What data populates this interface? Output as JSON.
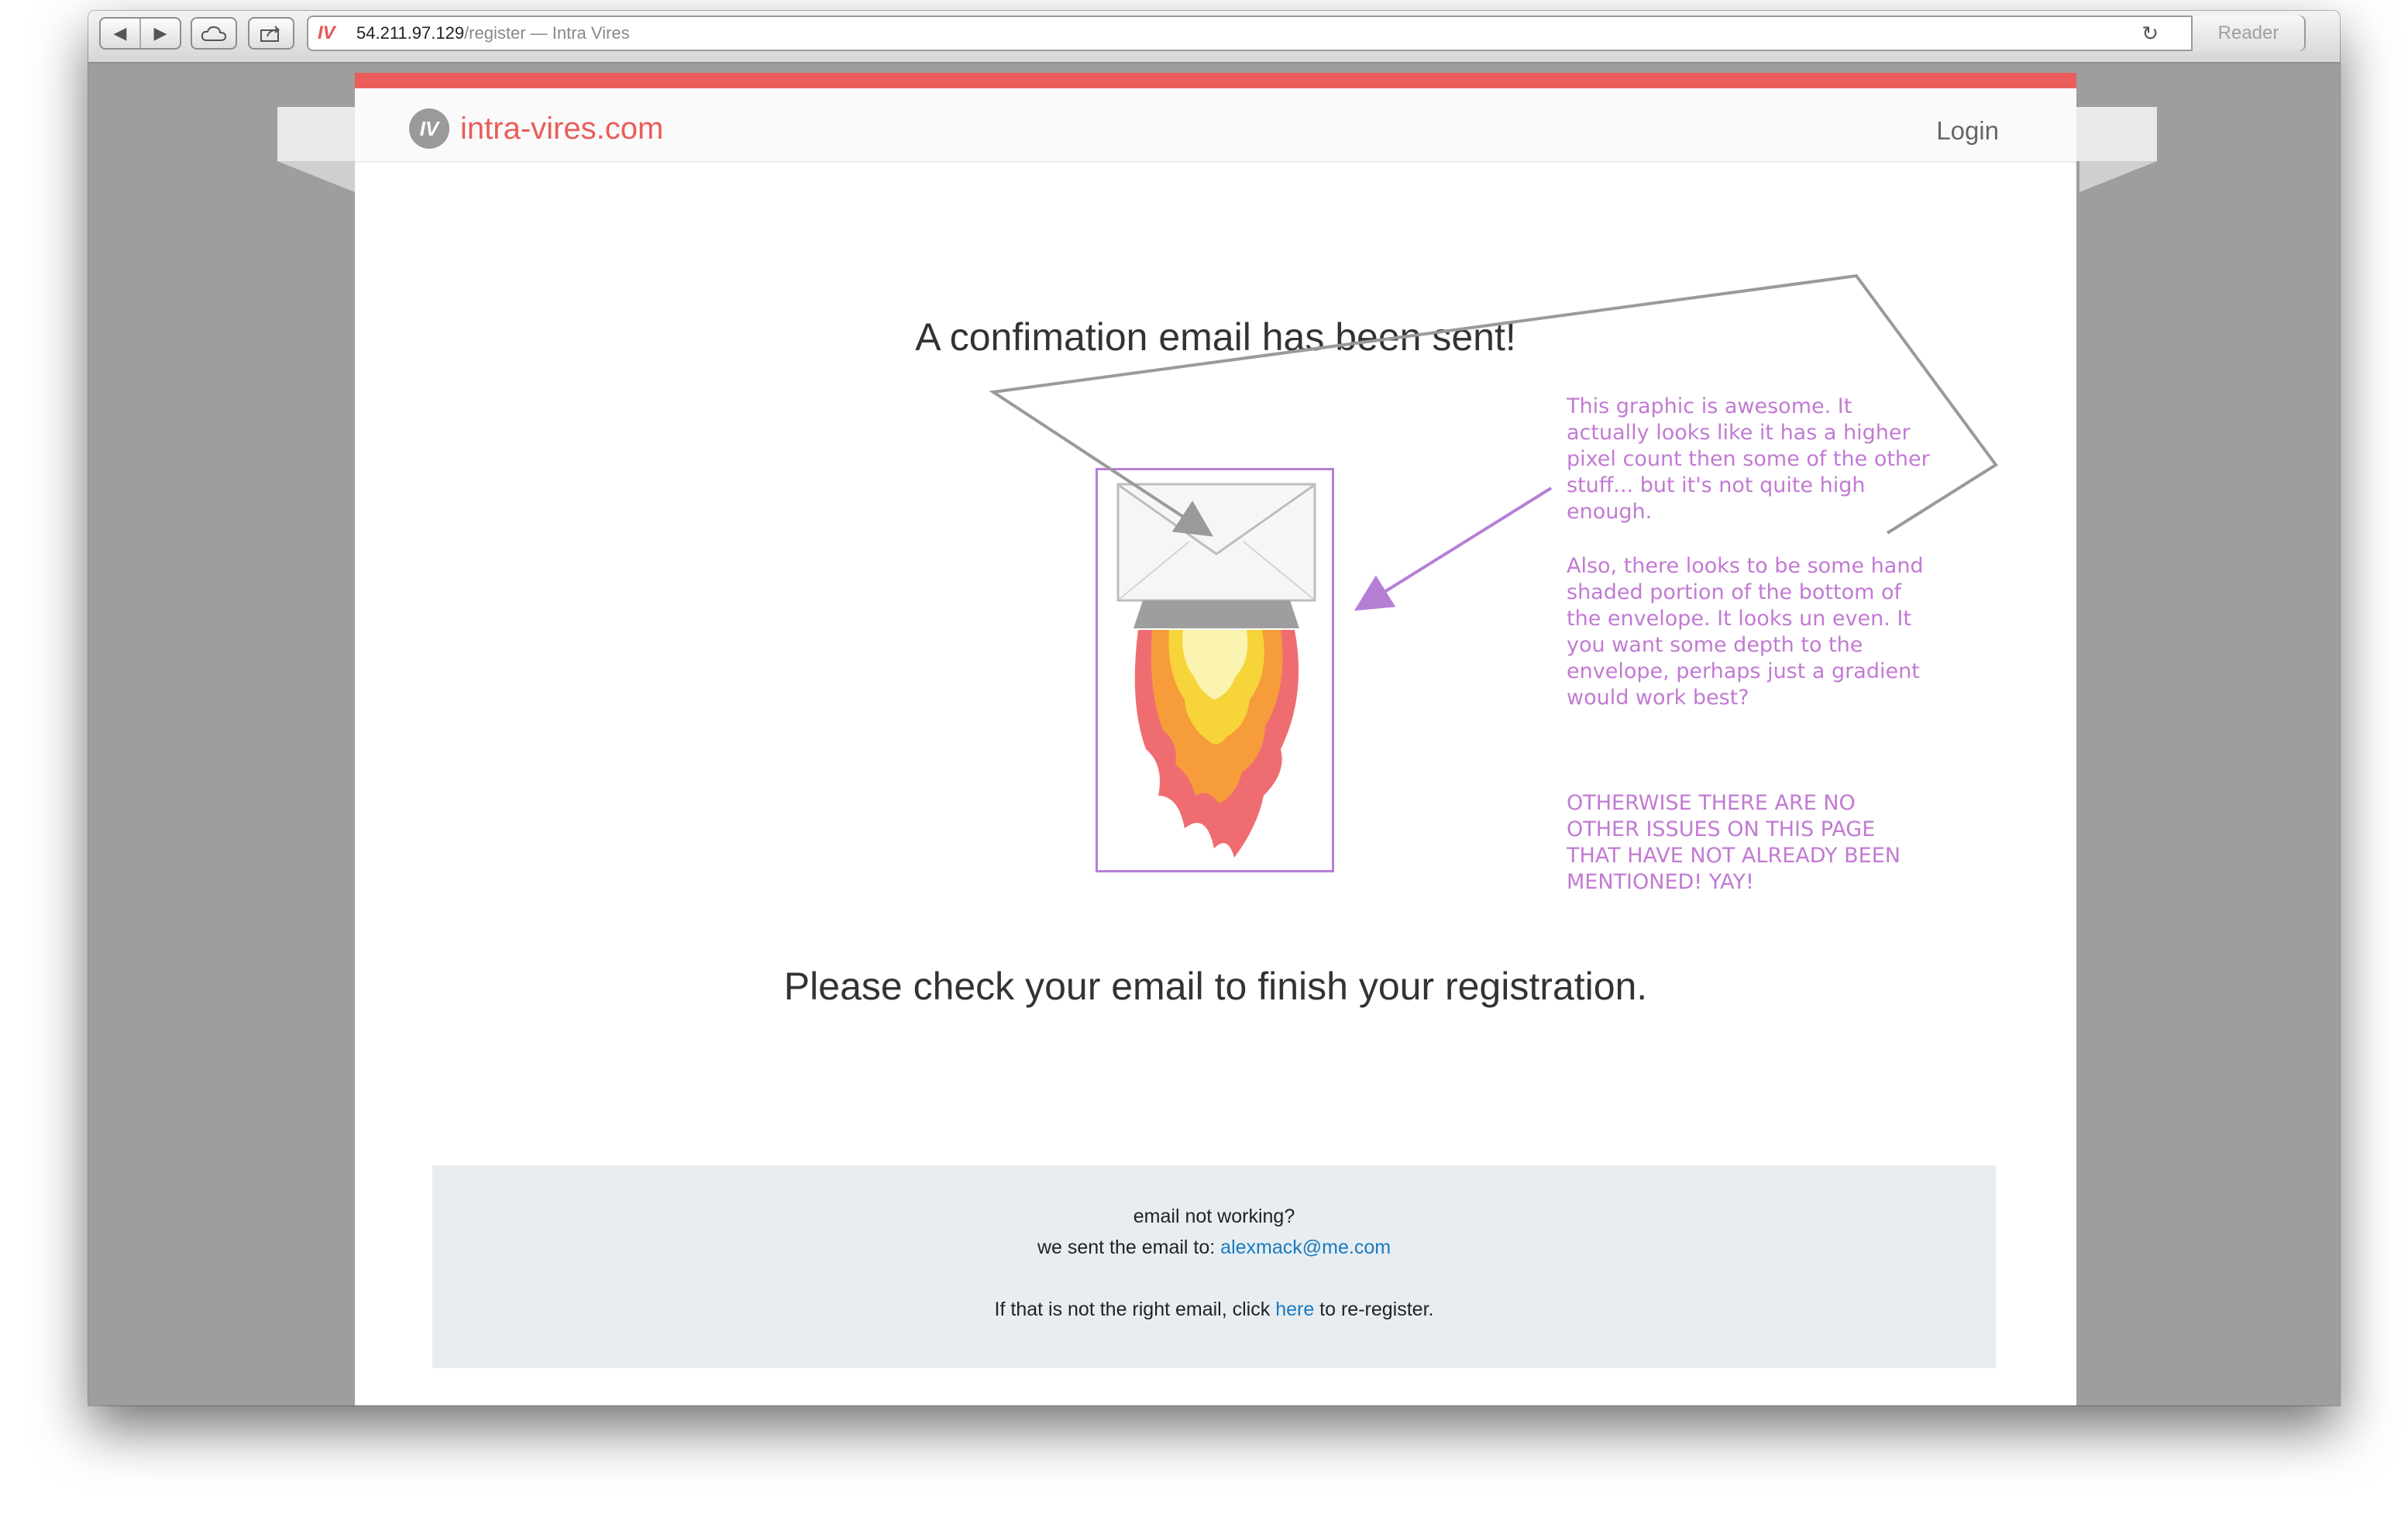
{
  "browser": {
    "host": "54.211.97.129",
    "path_title": "/register — Intra Vires",
    "reader_label": "Reader",
    "back_icon": "back-arrow-icon",
    "forward_icon": "forward-arrow-icon"
  },
  "site": {
    "logo_mark": "IV",
    "logo_text": "intra-vires.com",
    "login_label": "Login",
    "accent_color": "#ea5d5a"
  },
  "main": {
    "headline": "A confimation email has been sent!",
    "subline": "Please check your email to finish your registration."
  },
  "annotations": {
    "note1": "This graphic is awesome. It actually looks like it has a higher pixel count then some of the other stuff... but it's not quite high enough.",
    "note2": "Also, there looks to be some hand shaded portion of the bottom of the envelope. It looks un even. It you want some depth to the envelope, perhaps just a gradient would work best?",
    "note3": "OTHERWISE THERE ARE NO OTHER ISSUES ON THIS PAGE THAT HAVE NOT ALREADY BEEN MENTIONED! YAY!",
    "annotation_color": "#c27ad3"
  },
  "footer": {
    "line1": "email not working?",
    "line2_prefix": "we sent the email to: ",
    "email": "alexmack@me.com",
    "line3_prefix": "If that is not the right email, click ",
    "here_link": "here",
    "line3_suffix": " to re-register."
  }
}
